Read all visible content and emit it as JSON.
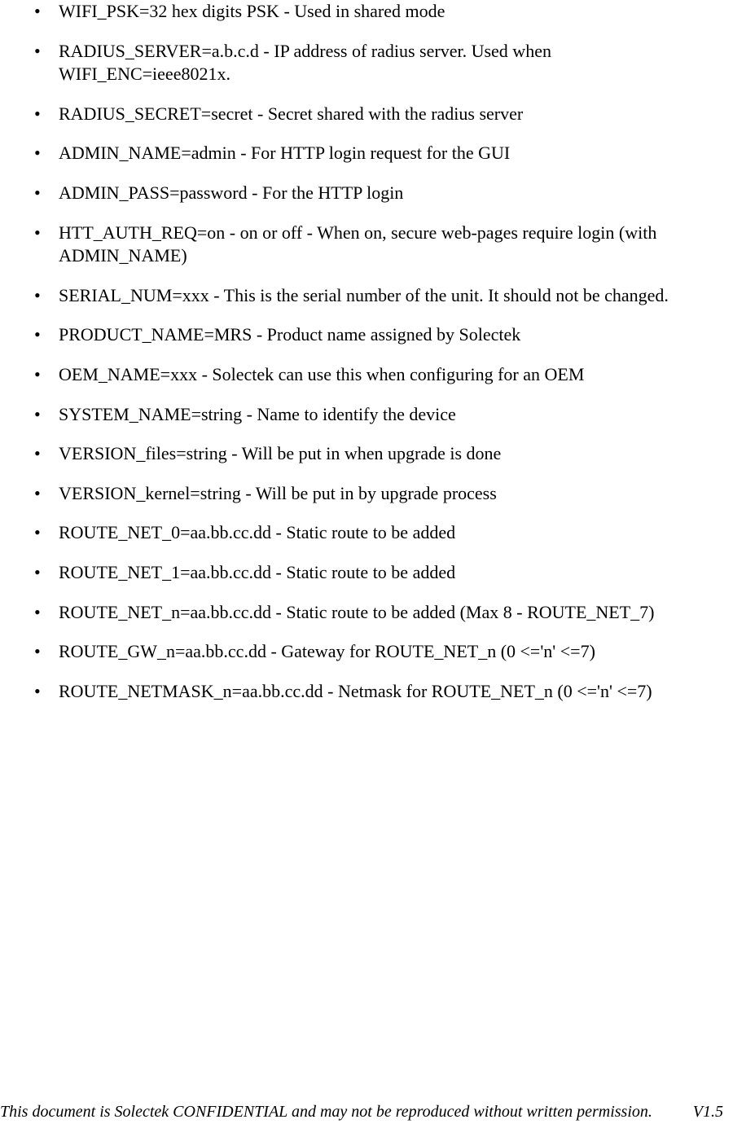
{
  "items": [
    "WIFI_PSK=32 hex digits PSK - Used in shared mode",
    "RADIUS_SERVER=a.b.c.d - IP address of radius server. Used when WIFI_ENC=ieee8021x.",
    "RADIUS_SECRET=secret - Secret shared with the radius server",
    "ADMIN_NAME=admin - For HTTP login request for the GUI",
    "ADMIN_PASS=password - For the HTTP login",
    "HTT_AUTH_REQ=on - on or off - When on, secure web-pages require login (with ADMIN_NAME)",
    "SERIAL_NUM=xxx - This is the serial number of the unit. It should not be changed.",
    "PRODUCT_NAME=MRS - Product name assigned by Solectek",
    "OEM_NAME=xxx - Solectek can use this when configuring for an OEM",
    "SYSTEM_NAME=string - Name to identify the device",
    "VERSION_files=string - Will be put in when upgrade is done",
    "VERSION_kernel=string - Will be put in by upgrade process",
    "ROUTE_NET_0=aa.bb.cc.dd - Static route to be added",
    "ROUTE_NET_1=aa.bb.cc.dd - Static route to be added",
    "ROUTE_NET_n=aa.bb.cc.dd - Static route to be added (Max 8 - ROUTE_NET_7)",
    "ROUTE_GW_n=aa.bb.cc.dd - Gateway for ROUTE_NET_n (0 <='n' <=7)",
    "ROUTE_NETMASK_n=aa.bb.cc.dd - Netmask for ROUTE_NET_n (0 <='n' <=7)"
  ],
  "footer": {
    "text": "This document is Solectek CONFIDENTIAL and may not be reproduced without written permission.",
    "version": "V1.5"
  }
}
